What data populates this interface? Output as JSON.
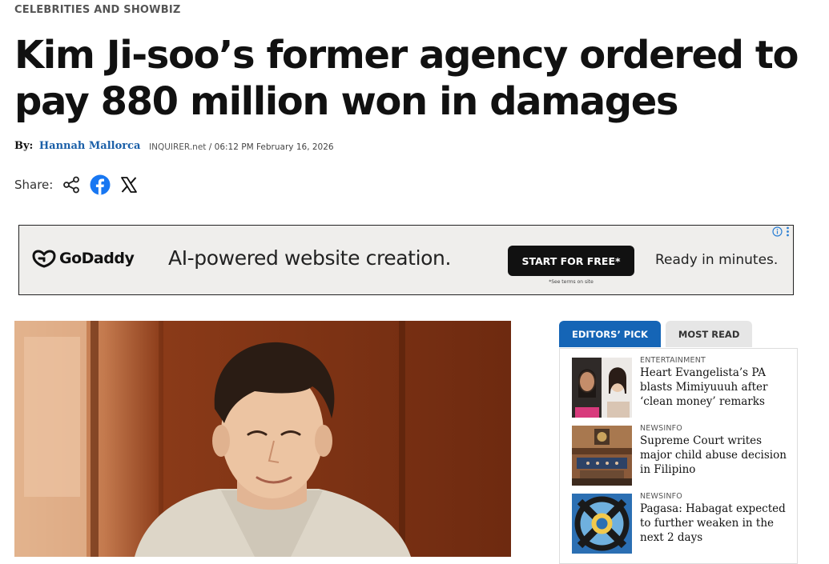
{
  "section": "CELEBRITIES AND SHOWBIZ",
  "headline": "Kim Ji-soo’s former agency ordered to pay 880 million won in damages",
  "byline": {
    "by": "By:",
    "author": "Hannah Mallorca"
  },
  "dateline": {
    "site": "INQUIRER.net",
    "separator": " / ",
    "datetime": "06:12 PM February 16, 2026"
  },
  "share": {
    "label": "Share:",
    "icons": [
      "share-icon",
      "facebook-icon",
      "x-icon"
    ]
  },
  "ad": {
    "brand": "GoDaddy",
    "headline": "AI-powered website creation.",
    "cta": "START FOR FREE*",
    "terms": "*See terms on site",
    "tagline": "Ready in minutes.",
    "choices_icons": [
      "info-icon",
      "kebab-icon"
    ]
  },
  "sidebar": {
    "tabs": [
      {
        "label": "EDITORS’ PICK",
        "active": true
      },
      {
        "label": "MOST READ",
        "active": false
      }
    ],
    "items": [
      {
        "category": "ENTERTAINMENT",
        "title": "Heart Evangelista’s PA blasts Mimiyuuuh after ‘clean money’ remarks"
      },
      {
        "category": "NEWSINFO",
        "title": "Supreme Court writes major child abuse decision in Filipino"
      },
      {
        "category": "NEWSINFO",
        "title": "Pagasa: Habagat expected to further weaken in the next 2 days"
      }
    ]
  },
  "colors": {
    "link_blue": "#1a5fa8",
    "tab_active": "#1565b6",
    "facebook_blue": "#1877f2",
    "ad_bg": "#efeeec"
  }
}
